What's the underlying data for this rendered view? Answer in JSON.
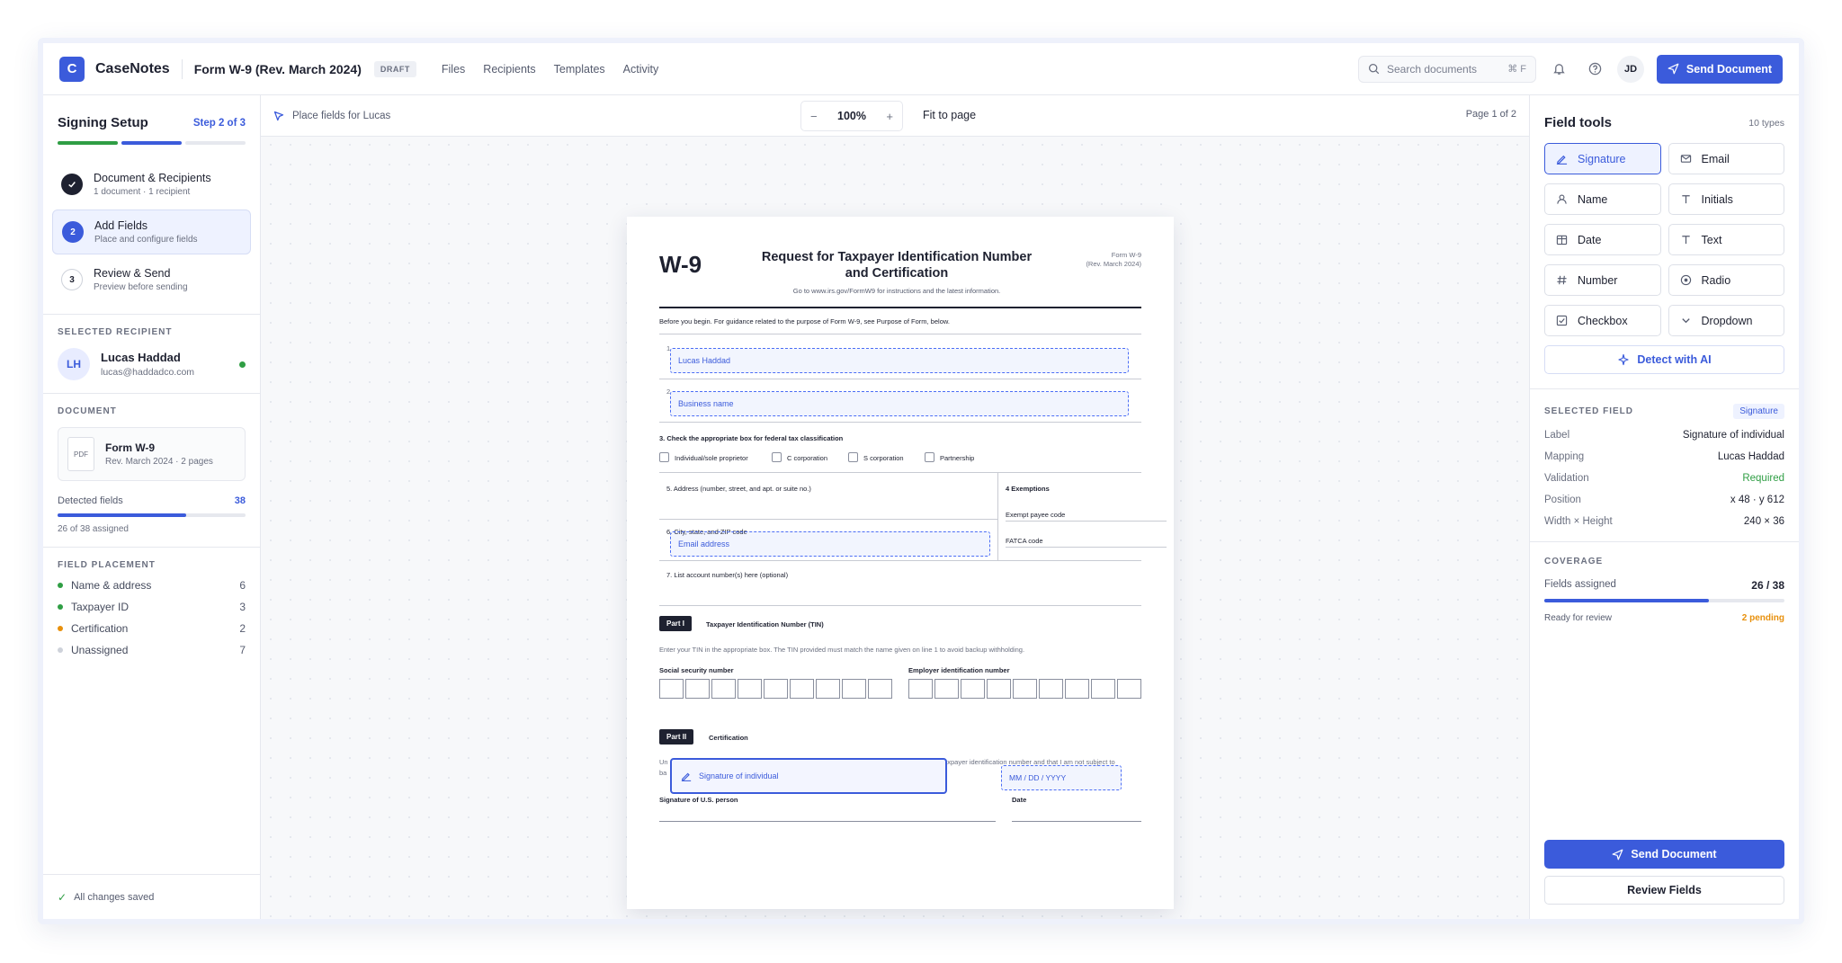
{
  "app": {
    "brand": "CaseNotes",
    "logo_letter": "C",
    "doc_title": "Form W-9 (Rev. March 2024)",
    "status_badge": "DRAFT"
  },
  "nav": [
    {
      "label": "Files"
    },
    {
      "label": "Recipients"
    },
    {
      "label": "Templates"
    },
    {
      "label": "Activity"
    }
  ],
  "search": {
    "placeholder": "Search documents",
    "shortcut": "⌘ F"
  },
  "user": {
    "initials": "JD"
  },
  "topbar": {
    "send_label": "Send Document"
  },
  "left": {
    "title": "Signing Setup",
    "step_indicator": "Step 2 of 3",
    "steps": [
      {
        "label": "Document & Recipients",
        "sub": "1 document · 1 recipient",
        "state": "done"
      },
      {
        "num": "2",
        "label": "Add Fields",
        "sub": "Place and configure fields",
        "state": "active"
      },
      {
        "num": "3",
        "label": "Review & Send",
        "sub": "Preview before sending",
        "state": "todo"
      }
    ],
    "recipient_label": "SELECTED RECIPIENT",
    "recipient": {
      "initials": "LH",
      "name": "Lucas Haddad",
      "email": "lucas@haddadco.com"
    },
    "document_label": "DOCUMENT",
    "document": {
      "icon_label": "PDF",
      "name": "Form W-9",
      "meta": "Rev. March 2024 · 2 pages"
    },
    "detected_label": "Detected fields",
    "detected_count": "38",
    "assigned_progress": 0.684,
    "assigned_text": "26 of 38 assigned",
    "placement_label": "FIELD PLACEMENT",
    "placement": [
      {
        "label": "Name & address",
        "count": "6",
        "color": "#2f9e44"
      },
      {
        "label": "Taxpayer ID",
        "count": "3",
        "color": "#2f9e44"
      },
      {
        "label": "Certification",
        "count": "2",
        "color": "#e8900c"
      },
      {
        "label": "Unassigned",
        "count": "7",
        "color": "#ced2da"
      }
    ],
    "saved_text": "All changes saved"
  },
  "canvas": {
    "hint": "Place fields for Lucas",
    "zoom": "100%",
    "fit_label": "Fit to page",
    "page_indicator": "Page 1 of 2"
  },
  "form": {
    "code": "W-9",
    "title_line1": "Request for Taxpayer Identification Number",
    "title_line2": "and Certification",
    "instructions_url": "Go to www.irs.gov/FormW9 for instructions and the latest information.",
    "corner_line1": "Form W-9",
    "corner_line2": "(Rev. March 2024)",
    "before_begin": "Before you begin. For guidance related to the purpose of Form W-9, see Purpose of Form, below.",
    "line1_num": "1",
    "line2_num": "2",
    "line3": "3. Check the appropriate box for federal tax classification",
    "classes": [
      "Individual/sole proprietor",
      "C corporation",
      "S corporation",
      "Partnership"
    ],
    "line4": "4 Exemptions",
    "exempt_payee": "Exempt payee code",
    "fatca": "FATCA code",
    "line5": "5. Address (number, street, and apt. or suite no.)",
    "line6": "6. City, state, and ZIP code",
    "line7": "7. List account number(s) here (optional)",
    "part1_badge": "Part I",
    "part1_title": "Taxpayer Identification Number (TIN)",
    "part1_text": "Enter your TIN in the appropriate box. The TIN provided must match the name given on line 1 to avoid backup withholding.",
    "ssn_label": "Social security number",
    "ein_label": "Employer identification number",
    "part2_badge": "Part II",
    "part2_title": "Certification",
    "cert_text_left": "Un",
    "cert_text_left2": "ba",
    "cert_text_right": "taxpayer identification number and that I am not subject to",
    "sig_label": "Signature of U.S. person",
    "date_label": "Date"
  },
  "fields": {
    "name": "Lucas Haddad",
    "business": "Business name",
    "email": "Email address",
    "signature": "Signature of individual",
    "date": "MM / DD / YYYY"
  },
  "right": {
    "title": "Field tools",
    "count": "10 types",
    "tools": [
      {
        "label": "Signature",
        "icon": "signature-icon",
        "active": true
      },
      {
        "label": "Email",
        "icon": "mail-icon"
      },
      {
        "label": "Name",
        "icon": "user-icon"
      },
      {
        "label": "Initials",
        "icon": "text-icon"
      },
      {
        "label": "Date",
        "icon": "calendar-icon"
      },
      {
        "label": "Text",
        "icon": "text-icon"
      },
      {
        "label": "Number",
        "icon": "hash-icon"
      },
      {
        "label": "Radio",
        "icon": "radio-icon"
      },
      {
        "label": "Checkbox",
        "icon": "checkbox-icon"
      },
      {
        "label": "Dropdown",
        "icon": "chevron-down-icon"
      }
    ],
    "detect_label": "Detect with AI",
    "selected_label": "SELECTED FIELD",
    "selected_badge": "Signature",
    "props": [
      {
        "k": "Label",
        "v": "Signature of individual"
      },
      {
        "k": "Mapping",
        "v": "Lucas Haddad"
      },
      {
        "k": "Validation",
        "v": "Required"
      },
      {
        "k": "Position",
        "v": "x 48 · y 612"
      },
      {
        "k": "Width × Height",
        "v": "240 × 36"
      }
    ],
    "coverage_label": "COVERAGE",
    "fields_assigned_label": "Fields assigned",
    "fields_assigned_value": "26 / 38",
    "coverage_progress": 0.684,
    "ready_label": "Ready for review",
    "pending_label": "2 pending",
    "send_label": "Send Document",
    "review_label": "Review Fields"
  },
  "colors": {
    "accent": "#3b5bdb",
    "success": "#2f9e44",
    "warning": "#e8900c"
  }
}
